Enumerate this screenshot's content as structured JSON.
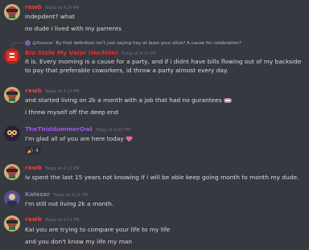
{
  "colors": {
    "background": "#36393f",
    "rawb_name": "#e04848",
    "bio_name": "#ef2f2f",
    "mod_name": "#9a59e0",
    "kalazar_name": "#7d8a9a",
    "timestamp": "#72767d"
  },
  "messages": [
    {
      "author": "rawb",
      "timestamp": "Today at 4:10 PM",
      "lines": [
        "indepdent? what",
        "no dude i lived with my parrents"
      ]
    },
    {
      "reply_to_author": "@Kalazar",
      "reply_text": "By that definition isn't just saying hey at least your alive? A cause for celebration?",
      "author": "Bio Stole My Valor (He/Him)",
      "timestamp": "Today at 4:10 PM",
      "text": "It is. Every morning is a cause for a party, and if i didnt have bills flowing out of my backside to pay that preferable coworkers, id throw a party almost every day."
    },
    {
      "author": "rawb",
      "timestamp": "Today at 4:10 PM",
      "lines": [
        "and started living on 2k a month with a job that had no gurantees",
        "i threw myself off the deep end"
      ],
      "emoji": "grimace-emoji"
    },
    {
      "author": "TheThiddummerOwl",
      "timestamp": "Today at 4:10 PM",
      "lines": [
        "I'm glad all of you are here today"
      ],
      "emoji": "heart-emoji",
      "reaction_count": "4",
      "reaction_icon": "party-popper-icon"
    },
    {
      "author": "rawb",
      "timestamp": "Today at 4:11 PM",
      "lines": [
        "iv spent the last 15 years not knowing if i will be able keep going month to month my dude."
      ]
    },
    {
      "author": "Kalazar",
      "timestamp": "Today at 4:11 PM",
      "lines": [
        "I'm still not living 2k a month."
      ]
    },
    {
      "author": "rawb",
      "timestamp": "Today at 4:11 PM",
      "lines": [
        "Kal you are trying to compare your life to my life",
        "and you don't know my life my man"
      ]
    }
  ]
}
